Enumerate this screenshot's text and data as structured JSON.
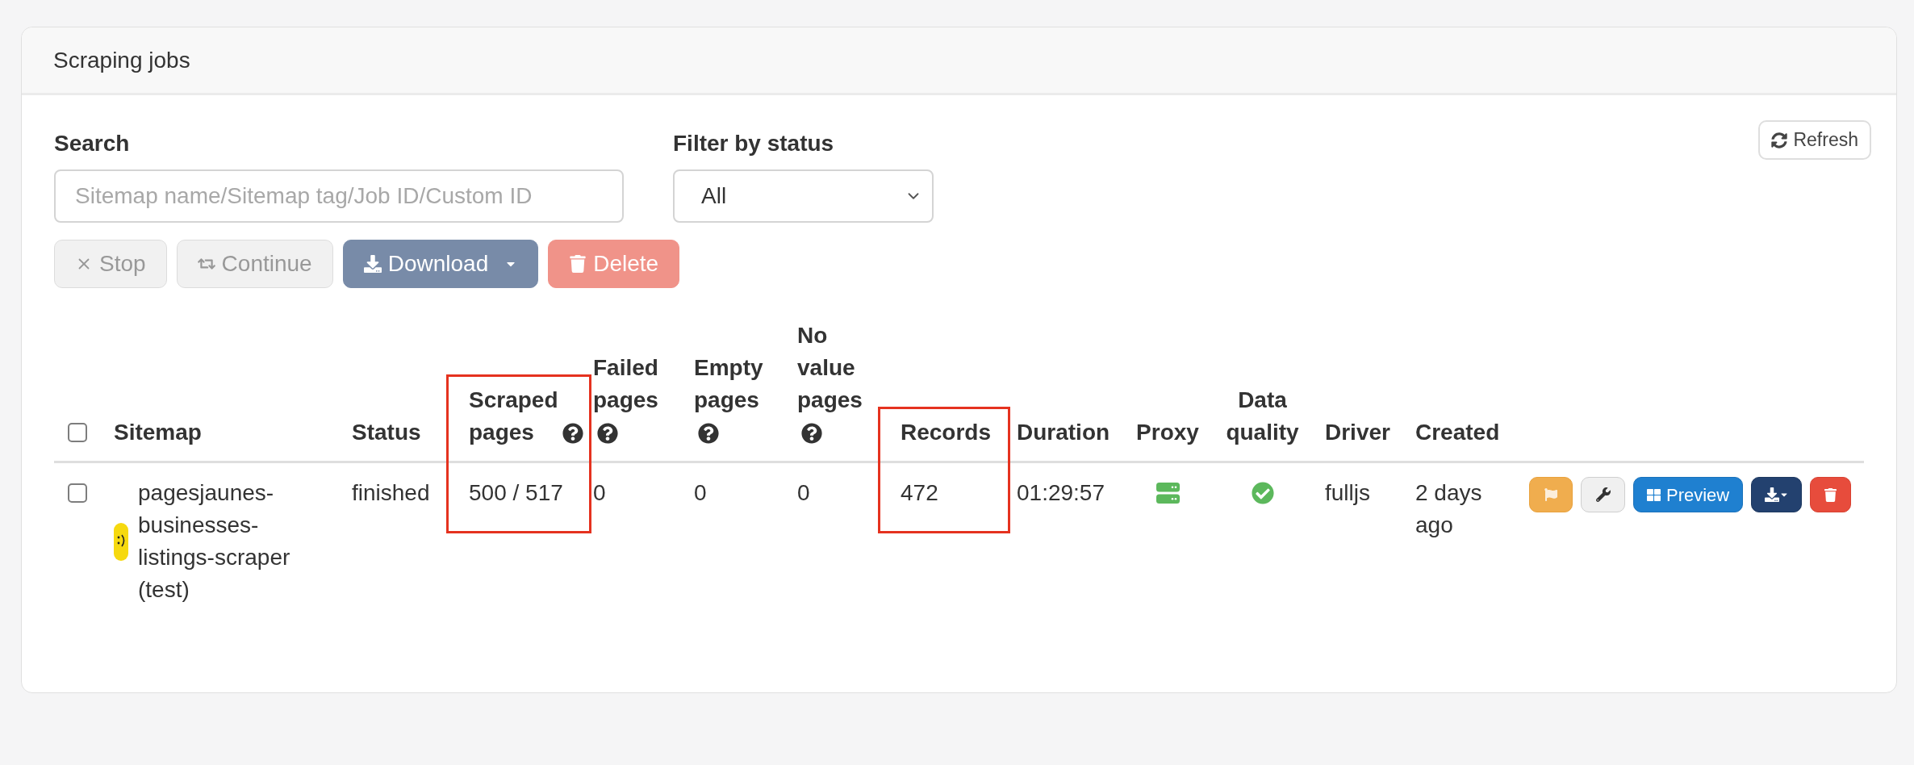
{
  "panel": {
    "title": "Scraping jobs"
  },
  "search": {
    "label": "Search",
    "placeholder": "Sitemap name/Sitemap tag/Job ID/Custom ID"
  },
  "status_filter": {
    "label": "Filter by status",
    "value": "All"
  },
  "refresh_button": {
    "label": "Refresh"
  },
  "bulk_actions": [
    {
      "kind": "stop",
      "label": "Stop",
      "disabled": true
    },
    {
      "kind": "continue",
      "label": "Continue",
      "disabled": true
    },
    {
      "kind": "download",
      "label": "Download",
      "disabled": true
    },
    {
      "kind": "delete",
      "label": "Delete",
      "disabled": true
    }
  ],
  "table": {
    "select_all": {
      "checked": false
    },
    "columns": [
      {
        "label": "Sitemap",
        "help": false,
        "highlighted": false
      },
      {
        "label": "Status",
        "help": false,
        "highlighted": false
      },
      {
        "label": "Scraped pages",
        "help": true,
        "highlighted": true
      },
      {
        "label": "Failed pages",
        "help": true,
        "highlighted": false
      },
      {
        "label": "Empty pages",
        "help": true,
        "highlighted": false
      },
      {
        "label": "No value pages",
        "help": true,
        "highlighted": false
      },
      {
        "label": "Records",
        "help": false,
        "highlighted": true
      },
      {
        "label": "Duration",
        "help": false,
        "highlighted": false
      },
      {
        "label": "Proxy",
        "help": false,
        "highlighted": false
      },
      {
        "label": "Data quality",
        "help": false,
        "highlighted": false
      },
      {
        "label": "Driver",
        "help": false,
        "highlighted": false
      },
      {
        "label": "Created",
        "help": false,
        "highlighted": false
      }
    ],
    "rows": [
      {
        "checked": false,
        "cells": [
          {
            "kind": "sitemap",
            "text": "pagesjaunes-businesses-listings-scraper (test)"
          },
          {
            "kind": "text",
            "text": "finished"
          },
          {
            "kind": "text",
            "text": "500 / 517"
          },
          {
            "kind": "text",
            "text": "0"
          },
          {
            "kind": "text",
            "text": "0"
          },
          {
            "kind": "text",
            "text": "0"
          },
          {
            "kind": "text",
            "text": "472"
          },
          {
            "kind": "text",
            "text": "01:29:57"
          },
          {
            "kind": "proxy",
            "on": true
          },
          {
            "kind": "quality",
            "ok": true
          },
          {
            "kind": "text",
            "text": "fulljs"
          },
          {
            "kind": "text",
            "text": "2 days ago"
          }
        ],
        "actions": [
          {
            "kind": "flag"
          },
          {
            "kind": "settings"
          },
          {
            "kind": "preview",
            "label": "Preview"
          },
          {
            "kind": "download"
          },
          {
            "kind": "delete"
          }
        ]
      }
    ]
  }
}
